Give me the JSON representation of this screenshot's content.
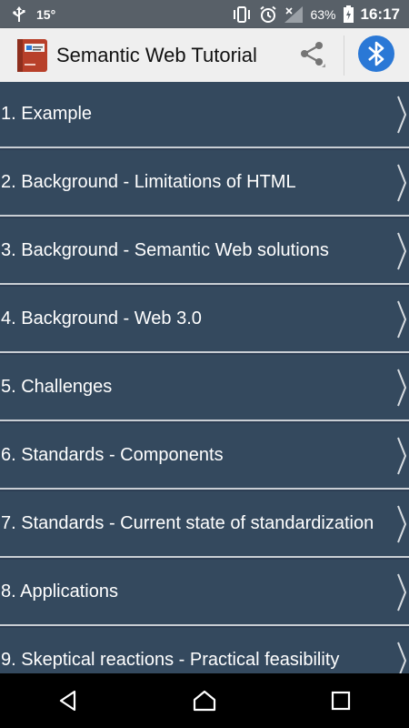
{
  "status_bar": {
    "temperature": "15°",
    "battery_percent": "63%",
    "time": "16:17",
    "icons": [
      "usb-icon",
      "vibrate-icon",
      "alarm-icon",
      "signal-icon",
      "battery-icon"
    ]
  },
  "app_bar": {
    "title": "Semantic Web Tutorial",
    "share_icon": "share-icon",
    "bluetooth_icon": "bluetooth-icon",
    "colors": {
      "background": "#efefef",
      "bluetooth_blue": "#2a78d6"
    }
  },
  "list": {
    "items": [
      {
        "label": "1. Example"
      },
      {
        "label": "2. Background - Limitations of HTML"
      },
      {
        "label": "3. Background - Semantic Web solutions"
      },
      {
        "label": "4. Background - Web 3.0"
      },
      {
        "label": "5. Challenges"
      },
      {
        "label": "6. Standards - Components"
      },
      {
        "label": "7. Standards - Current state of standardization"
      },
      {
        "label": "8. Applications"
      },
      {
        "label": "9. Skeptical reactions - Practical feasibility"
      }
    ],
    "colors": {
      "item_background": "#34495e",
      "divider": "#c9ced4",
      "text": "#ffffff"
    }
  },
  "nav_bar": {
    "buttons": [
      "back-icon",
      "home-icon",
      "recents-icon"
    ]
  }
}
